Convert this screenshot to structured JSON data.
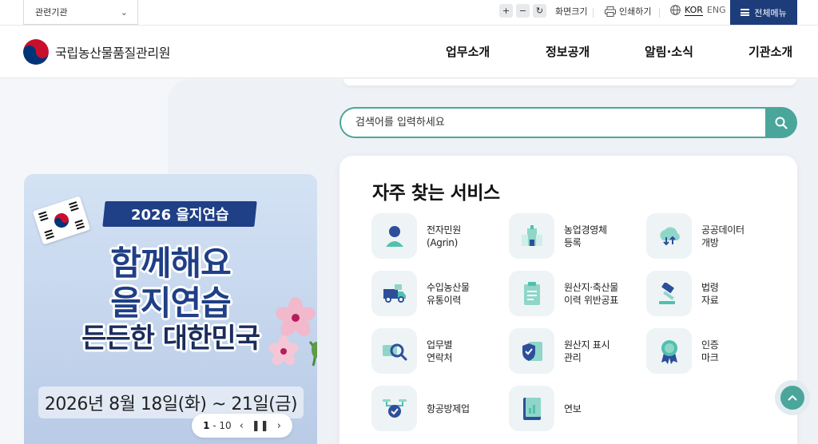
{
  "utility": {
    "related_label": "관련기관",
    "zoom_in": "+",
    "zoom_out": "−",
    "zoom_reset": "↻",
    "zoom_label": "화면크기",
    "print_label": "인쇄하기",
    "lang_kor": "KOR",
    "lang_eng": "ENG",
    "all_menu": "전체메뉴"
  },
  "header": {
    "logo_text": "국립농산물품질관리원",
    "nav": [
      "업무소개",
      "정보공개",
      "알림·소식",
      "기관소개"
    ]
  },
  "search": {
    "placeholder": "검색어를 입력하세요"
  },
  "banner": {
    "ribbon": "2026 을지연습",
    "line1": "함께해요",
    "line2": "을지연습",
    "line3": "든든한 대한민국",
    "date": "2026년 8월 18일(화) ~ 21일(금)",
    "pager_current": "1",
    "pager_total": "- 10"
  },
  "services": {
    "title": "자주 찾는 서비스",
    "items": [
      {
        "label": "전자민원\n(Agrin)",
        "icon": "person-icon"
      },
      {
        "label": "농업경영체\n등록",
        "icon": "building-icon"
      },
      {
        "label": "공공데이터\n개방",
        "icon": "cloud-data-icon"
      },
      {
        "label": "수입농산물\n유통이력",
        "icon": "truck-icon"
      },
      {
        "label": "원산지·축산물\n이력 위반공표",
        "icon": "clipboard-icon"
      },
      {
        "label": "법령\n자료",
        "icon": "gavel-icon"
      },
      {
        "label": "업무별\n연락처",
        "icon": "search-card-icon"
      },
      {
        "label": "원산지 표시\n관리",
        "icon": "shield-doc-icon"
      },
      {
        "label": "인증\n마크",
        "icon": "badge-icon"
      },
      {
        "label": "항공방제업",
        "icon": "drone-icon"
      },
      {
        "label": "연보",
        "icon": "book-icon"
      }
    ]
  },
  "colors": {
    "accent": "#4aa69a",
    "navy": "#1d3d7a"
  }
}
